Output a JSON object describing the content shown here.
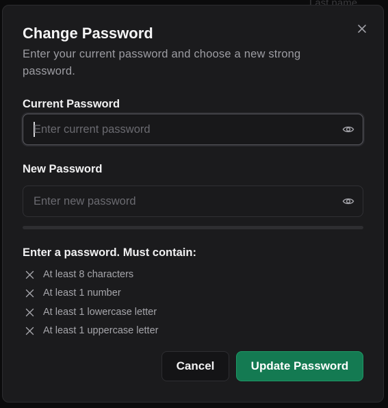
{
  "background": {
    "partial_label": "Last name"
  },
  "dialog": {
    "title": "Change Password",
    "description": "Enter your current password and choose a new strong password."
  },
  "current_password": {
    "label": "Current Password",
    "placeholder": "Enter current password",
    "value": ""
  },
  "new_password": {
    "label": "New Password",
    "placeholder": "Enter new password",
    "value": ""
  },
  "strength_bar": {
    "level": 0
  },
  "requirements": {
    "heading": "Enter a password. Must contain:",
    "items": [
      {
        "label": "At least 8 characters",
        "met": false
      },
      {
        "label": "At least 1 number",
        "met": false
      },
      {
        "label": "At least 1 lowercase letter",
        "met": false
      },
      {
        "label": "At least 1 uppercase letter",
        "met": false
      }
    ]
  },
  "buttons": {
    "cancel": "Cancel",
    "update": "Update Password"
  },
  "icons": {
    "close": "close-icon",
    "toggle_visibility": "eye-icon",
    "requirement_status": "x-mark-icon"
  },
  "colors": {
    "primary": "#147a52",
    "dialog_bg": "#1b1b1d"
  }
}
